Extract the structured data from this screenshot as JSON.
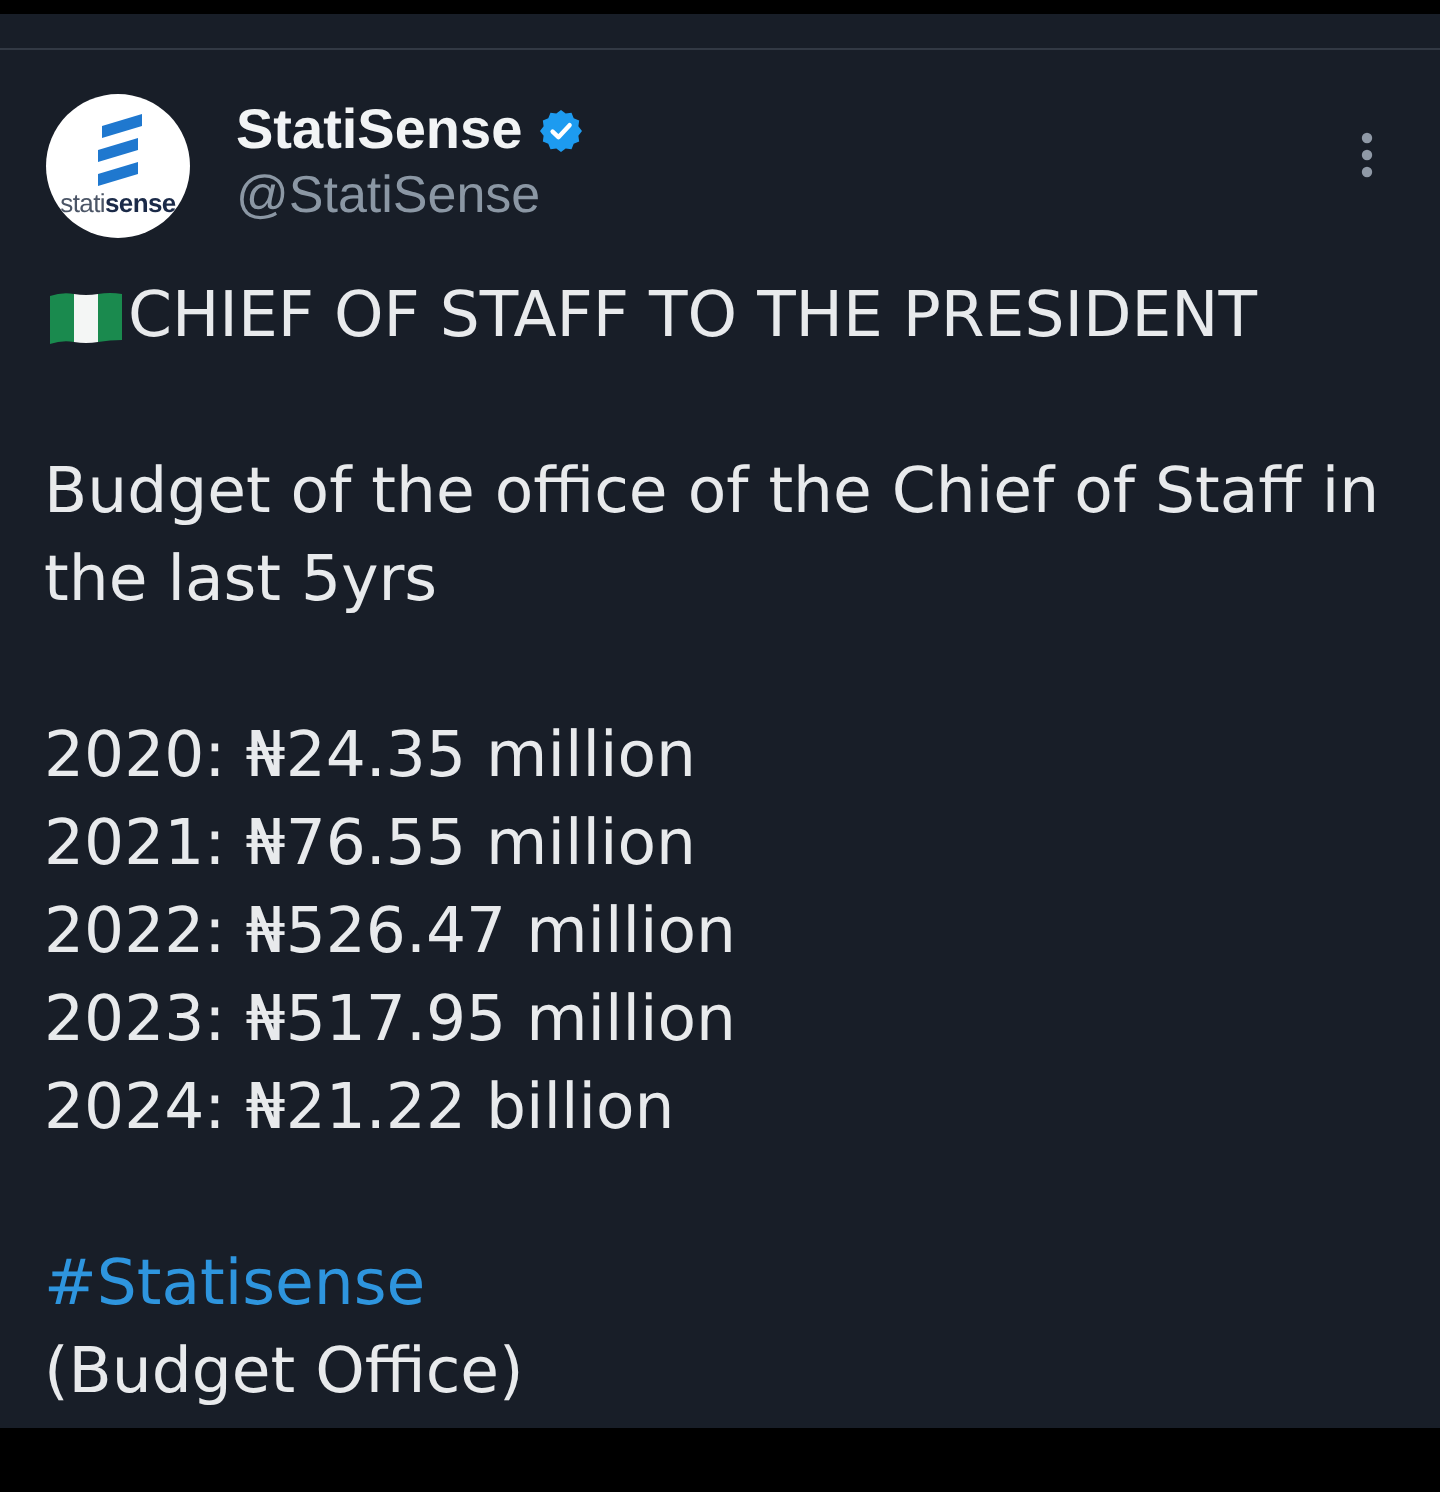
{
  "post": {
    "author": {
      "logo_text": "stati**sense**",
      "name": "StatiSense",
      "verified": true,
      "handle": "@StatiSense"
    },
    "headline": "CHIEF OF STAFF TO THE PRESIDENT",
    "intro": "Budget of the office of the Chief of Staff in the last 5yrs",
    "budget_lines": [
      "2020: ₦24.35 million",
      "2021: ₦76.55 million",
      "2022: ₦526.47 million",
      "2023: ₦517.95 million",
      "2024: ₦21.22 billion"
    ],
    "hashtag": "#Statisense",
    "source": "(Budget Office)"
  }
}
